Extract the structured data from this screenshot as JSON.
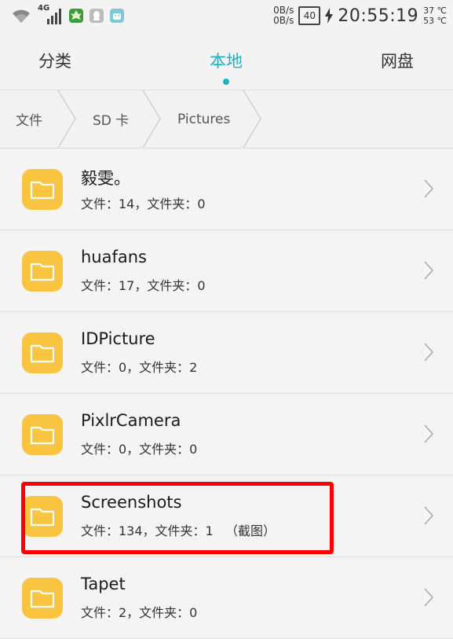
{
  "status_bar": {
    "network_type": "4G",
    "speed_up": "0B/s",
    "speed_down": "0B/s",
    "battery_level": "40",
    "time": "20:55:19",
    "temp_1": "37 ℃",
    "temp_2": "53 ℃"
  },
  "tabs": [
    {
      "label": "分类",
      "active": false
    },
    {
      "label": "本地",
      "active": true
    },
    {
      "label": "网盘",
      "active": false
    }
  ],
  "breadcrumb": [
    {
      "label": "文件"
    },
    {
      "label": "SD 卡"
    },
    {
      "label": "Pictures"
    }
  ],
  "folders": [
    {
      "name": "毅雯。",
      "info": "文件：14，文件夹：0"
    },
    {
      "name": "huafans",
      "info": "文件：17，文件夹：0"
    },
    {
      "name": "IDPicture",
      "info": "文件：0，文件夹：2"
    },
    {
      "name": "PixlrCamera",
      "info": "文件：0，文件夹：0"
    },
    {
      "name": "Screenshots",
      "info": "文件：134，文件夹：1   （截图）"
    },
    {
      "name": "Tapet",
      "info": "文件：2，文件夹：0"
    }
  ],
  "colors": {
    "accent": "#19b3c4",
    "folder": "#f9c440",
    "highlight": "#ff0000"
  }
}
